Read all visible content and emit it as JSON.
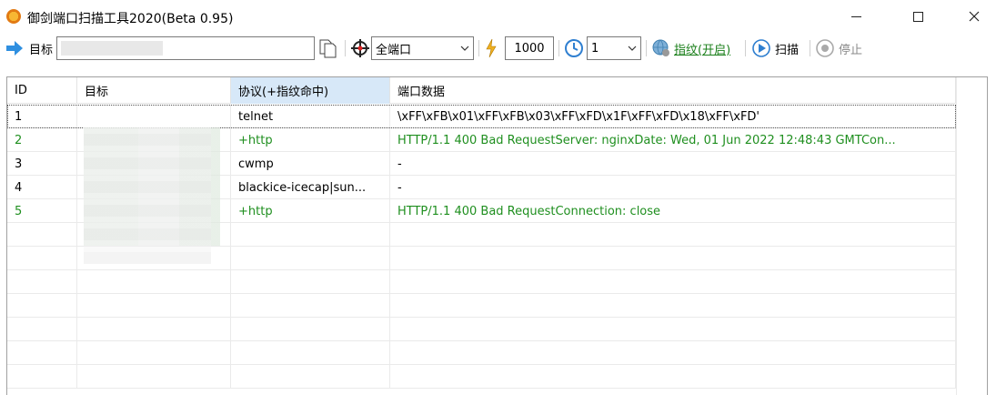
{
  "window": {
    "title": "御剑端口扫描工具2020(Beta 0.95)"
  },
  "toolbar": {
    "target_label": "目标",
    "target_value": "",
    "port_mode": "全端口",
    "threads": "1000",
    "timeout": "1",
    "fingerprint_label": "指纹(开启)",
    "scan_label": "扫描",
    "stop_label": "停止"
  },
  "table": {
    "columns": [
      "ID",
      "目标",
      "协议(+指纹命中)",
      "端口数据"
    ],
    "rows": [
      {
        "id": "1",
        "target": "",
        "protocol": "telnet",
        "data": "\\xFF\\xFB\\x01\\xFF\\xFB\\x03\\xFF\\xFD\\x1F\\xFF\\xFD\\x18\\xFF\\xFD'",
        "green": false,
        "selected": true
      },
      {
        "id": "2",
        "target": "",
        "protocol": "+http",
        "data": "HTTP/1.1 400 Bad RequestServer: nginxDate: Wed, 01 Jun 2022 12:48:43 GMTCon...",
        "green": true,
        "selected": false
      },
      {
        "id": "3",
        "target": "",
        "protocol": "cwmp",
        "data": "-",
        "green": false,
        "selected": false
      },
      {
        "id": "4",
        "target": "",
        "protocol": "blackice-icecap|sun...",
        "data": "-",
        "green": false,
        "selected": false
      },
      {
        "id": "5",
        "target": "",
        "protocol": "+http",
        "data": "HTTP/1.1 400 Bad RequestConnection: close",
        "green": true,
        "selected": false
      }
    ]
  },
  "colors": {
    "green_text": "#1f8f1f",
    "header_highlight": "#d7e8f8",
    "link_green": "#1a7f1a"
  }
}
